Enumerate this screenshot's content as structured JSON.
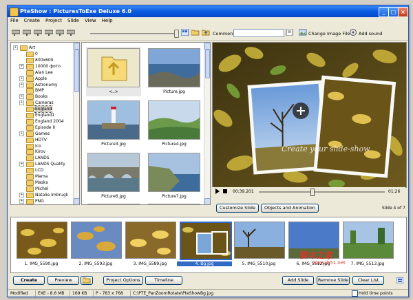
{
  "window": {
    "title": "PteShow : PicturesToExe Deluxe 6.0"
  },
  "menu": [
    "File",
    "Create",
    "Project",
    "Slide",
    "View",
    "Help"
  ],
  "toolbar": {
    "comment_label": "Comment",
    "comment_value": "",
    "change_image_label": "Change Image File",
    "add_sound_label": "Add sound"
  },
  "tree": {
    "root": "Art",
    "items": [
      "0",
      "800x600",
      "10000 фото",
      "Alan Lee",
      "Apple",
      "Astronomy",
      "BMP",
      "Books",
      "Cameras",
      "England",
      "England1",
      "England 2004",
      "Episode II",
      "Games",
      "HDTV",
      "Ico",
      "Kirov",
      "LANDS",
      "LANDS Quality",
      "LCD",
      "Mama",
      "Masks",
      "Michel",
      "Natalie Imbrugli",
      "PNG"
    ],
    "expandable": [
      false,
      false,
      true,
      false,
      true,
      true,
      false,
      true,
      true,
      false,
      false,
      false,
      false,
      true,
      false,
      false,
      false,
      false,
      true,
      false,
      false,
      false,
      false,
      true,
      true
    ],
    "selected_index": 9
  },
  "thumbnails": [
    {
      "caption": "<..>",
      "kind": "up-folder"
    },
    {
      "caption": "Picture.jpg",
      "kind": "coast"
    },
    {
      "caption": "Picture3.jpg",
      "kind": "lighthouse"
    },
    {
      "caption": "Picture4.jpg",
      "kind": "hills"
    },
    {
      "caption": "Picture6.jpg",
      "kind": "bridge"
    },
    {
      "caption": "Picture7.jpg",
      "kind": "cliffs"
    }
  ],
  "preview": {
    "overlay_text": "Create your slide-show",
    "time_current": "00:39.201",
    "time_total": "01:26",
    "progress": 0.42,
    "customize_label": "Customize Slide",
    "objects_label": "Objects and Animation",
    "slide_counter": "Slide 4 of 7"
  },
  "slides": [
    {
      "caption": "1. IMG_5590.jpg",
      "kind": "autumn"
    },
    {
      "caption": "2. IMG_5593.jpg",
      "kind": "autumn2"
    },
    {
      "caption": "3. IMG_5589.jpg",
      "kind": "autumn3"
    },
    {
      "caption": "4. Bg.jpg",
      "kind": "bg"
    },
    {
      "caption": "5. IMG_5510.jpg",
      "kind": "sky"
    },
    {
      "caption": "6. IMG_5512.jpg",
      "kind": "blue"
    },
    {
      "caption": "7. IMG_5513.jpg",
      "kind": "park"
    }
  ],
  "selected_slide": 3,
  "bottom": {
    "create": "Create",
    "preview": "Preview",
    "project_options": "Project Options",
    "timeline": "Timeline",
    "add_slide": "Add Slide",
    "remove_slide": "Remove Slide",
    "clear_list": "Clear List"
  },
  "watermark": {
    "text": "脚本之家",
    "url": "www.jb51.net"
  },
  "status": {
    "modified": "Modified",
    "exe_size": "EXE - 8.6 MB",
    "size_kb": "169 KB",
    "dims": "P - 783 x 768",
    "path": "C:\\PTE_PanZoomRotate\\PteShowBg.jpg",
    "hold_label": "Hold time points"
  },
  "colors": {
    "title_bar": "#0a5ae0",
    "selection": "#316ac5",
    "folder": "#f0cf6a"
  }
}
